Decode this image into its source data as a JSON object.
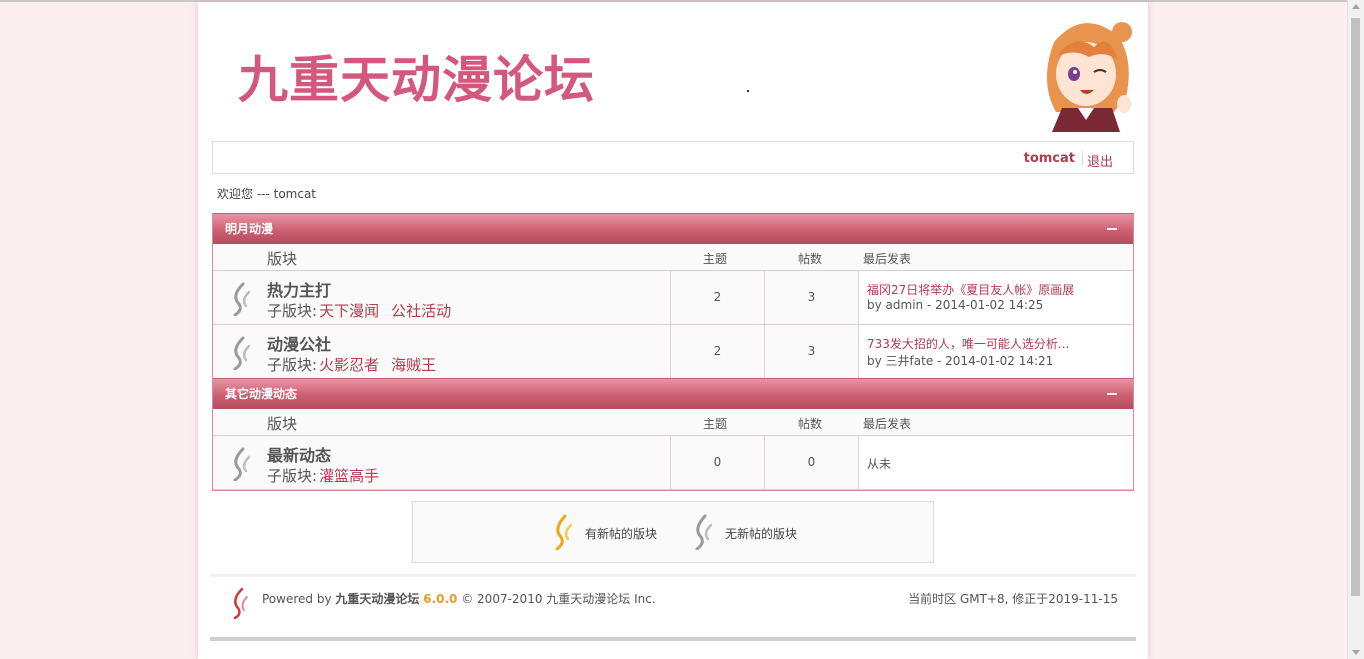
{
  "header": {
    "logo_text": "九重天动漫论坛",
    "mascot_icon": "anime-girl-mascot"
  },
  "userbar": {
    "username": "tomcat",
    "logout_label": "退出"
  },
  "welcome": "欢迎您 --- tomcat",
  "columns": {
    "board": "版块",
    "topics": "主题",
    "posts": "帖数",
    "last_post": "最后发表"
  },
  "categories": [
    {
      "title": "明月动漫",
      "forums": [
        {
          "name": "热力主打",
          "subs_label": "子版块:",
          "subs": [
            "天下漫闻",
            "公社活动"
          ],
          "topics": "2",
          "posts": "3",
          "last_title": "福冈27日将举办《夏目友人帐》原画展",
          "last_by": "by admin - 2014-01-02 14:25"
        },
        {
          "name": "动漫公社",
          "subs_label": "子版块:",
          "subs": [
            "火影忍者",
            "海贼王"
          ],
          "topics": "2",
          "posts": "3",
          "last_title": "733发大招的人，唯一可能人选分析...",
          "last_by": "by 三井fate - 2014-01-02 14:21"
        }
      ]
    },
    {
      "title": "其它动漫动态",
      "forums": [
        {
          "name": "最新动态",
          "subs_label": "子版块:",
          "subs": [
            "灌篮高手"
          ],
          "topics": "0",
          "posts": "0",
          "last_none": "从未"
        }
      ]
    }
  ],
  "legend": {
    "new_label": "有新帖的版块",
    "no_new_label": "无新帖的版块"
  },
  "footer": {
    "powered_prefix": "Powered by",
    "brand": "九重天动漫论坛",
    "version": "6.0.0",
    "copyright": "© 2007-2010 九重天动漫论坛 Inc.",
    "timezone": "当前时区 GMT+8, 修正于2019-11-15"
  },
  "colors": {
    "accent": "#b33b50",
    "header_gradient_top": "#e994a4",
    "header_gradient_bottom": "#b84a5d",
    "logo": "#d4577d",
    "version": "#e89a2a"
  }
}
